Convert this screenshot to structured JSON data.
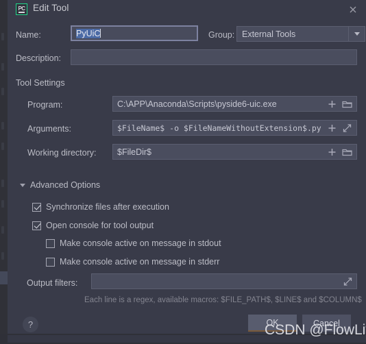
{
  "window": {
    "title": "Edit Tool",
    "app_icon": "pycharm-icon",
    "app_icon_text": "PC",
    "close_icon": "close-icon"
  },
  "form": {
    "name": {
      "label": "Name:",
      "value": "PyUiC",
      "selected_text": "PyUiC",
      "placeholder": ""
    },
    "group": {
      "label": "Group:",
      "value": "External Tools",
      "options": [
        "External Tools"
      ]
    },
    "description": {
      "label": "Description:",
      "value": "",
      "placeholder": ""
    }
  },
  "tool_settings": {
    "section_label": "Tool Settings",
    "program": {
      "label": "Program:",
      "value": "C:\\APP\\Anaconda\\Scripts\\pyside6-uic.exe",
      "insert_macro_icon": "plus-icon",
      "browse_icon": "folder-icon"
    },
    "arguments": {
      "label": "Arguments:",
      "value": "$FileName$ -o $FileNameWithoutExtension$.py",
      "insert_macro_icon": "plus-icon",
      "expand_icon": "expand-icon"
    },
    "working_directory": {
      "label": "Working directory:",
      "value": "$FileDir$",
      "insert_macro_icon": "plus-icon",
      "browse_icon": "folder-icon"
    }
  },
  "advanced": {
    "section_label": "Advanced Options",
    "expanded": true,
    "twisty_icon": "chevron-down-icon",
    "checkboxes": [
      {
        "label": "Synchronize files after execution",
        "checked": true
      },
      {
        "label": "Open console for tool output",
        "checked": true
      },
      {
        "label": "Make console active on message in stdout",
        "checked": false
      },
      {
        "label": "Make console active on message in stderr",
        "checked": false
      }
    ],
    "output_filters": {
      "label": "Output filters:",
      "value": "",
      "expand_icon": "expand-icon"
    },
    "hint": "Each line is a regex, available macros: $FILE_PATH$, $LINE$ and $COLUMN$"
  },
  "footer": {
    "help_label": "?",
    "ok_label": "OK",
    "cancel_label": "Cancel"
  },
  "watermark": {
    "text": "CSDN @FlowLiver"
  },
  "colors": {
    "dialog_bg": "#393b49",
    "field_bg": "#4a4d5e",
    "accent_green": "#21d789",
    "selection_blue": "#4b6aa5",
    "text": "#bcbdc6"
  }
}
